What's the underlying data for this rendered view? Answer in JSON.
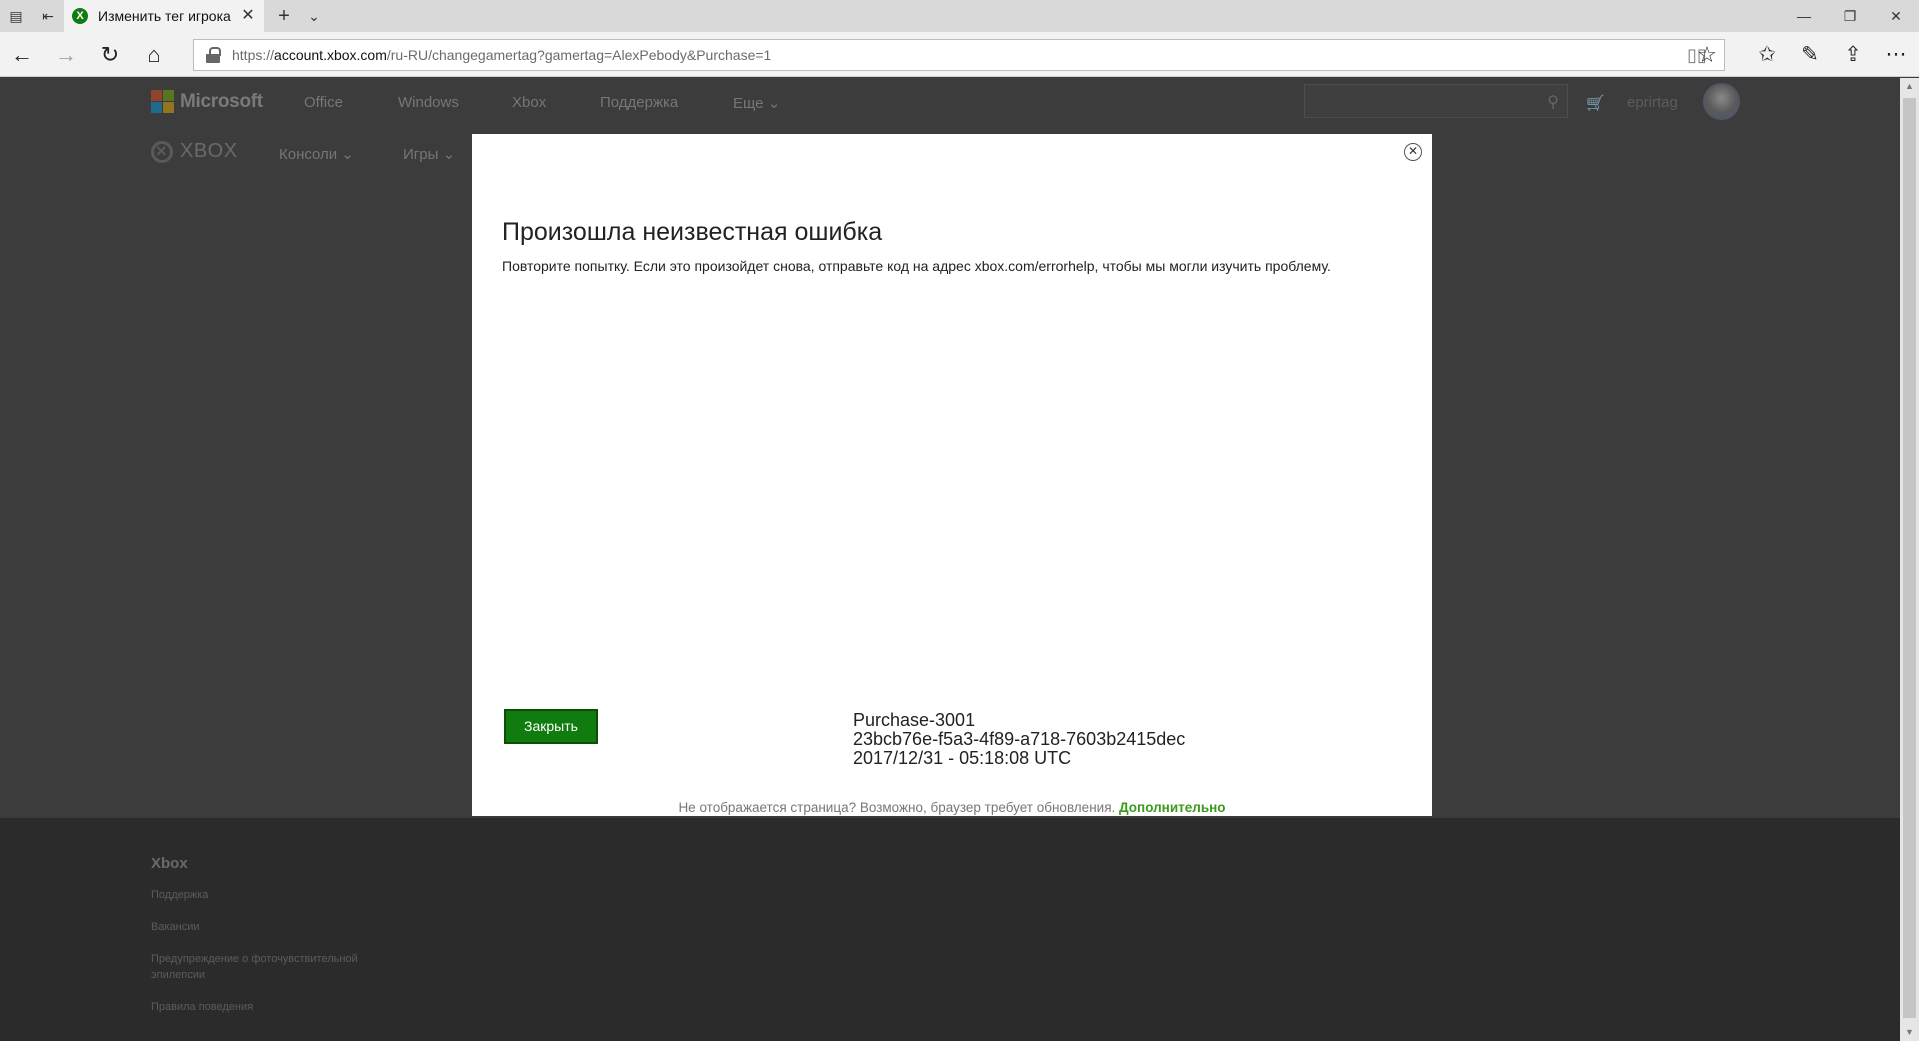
{
  "browser": {
    "tab_title": "Изменить тег игрока",
    "url_prefix": "https://",
    "url_host": "account.xbox.com",
    "url_path": "/ru-RU/changegamertag?gamertag=AlexPebody&Purchase=1"
  },
  "header": {
    "brand": "Microsoft",
    "nav": [
      "Office",
      "Windows",
      "Xbox",
      "Поддержка",
      "Еще"
    ],
    "username": "eprirtag",
    "xbox_brand": "XBOX",
    "subnav": [
      "Консоли",
      "Игры"
    ]
  },
  "modal": {
    "title": "Произошла неизвестная ошибка",
    "message": "Повторите попытку. Если это произойдет снова, отправьте код на адрес xbox.com/errorhelp, чтобы мы могли изучить проблему.",
    "close_label": "Закрыть",
    "error_code": "Purchase-3001",
    "error_id": "23bcb76e-f5a3-4f89-a718-7603b2415dec",
    "error_time": "2017/12/31 - 05:18:08 UTC",
    "browser_note": "Не отображается страница? Возможно, браузер требует обновления.",
    "browser_note_link": "Дополнительно"
  },
  "footer": {
    "heading": "Xbox",
    "links": [
      "Поддержка",
      "Вакансии",
      "Предупреждение о фоточувствительной эпилепсии",
      "Правила поведения"
    ]
  },
  "colors": {
    "accent_green": "#107c10",
    "link_green": "#3a9a20",
    "overlay": "#3c3c3c"
  }
}
